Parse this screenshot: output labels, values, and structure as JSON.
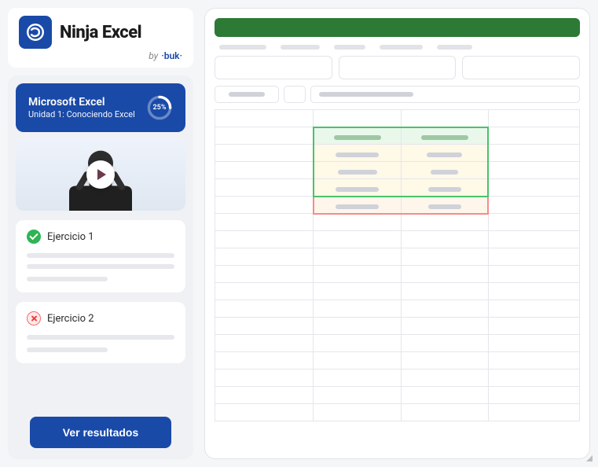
{
  "brand": {
    "name": "Ninja Excel",
    "by_prefix": "by",
    "by_brand": "·buk·"
  },
  "course": {
    "title": "Microsoft Excel",
    "subtitle": "Unidad 1: Conociendo Excel",
    "progress_pct": "25%",
    "progress_value": 25
  },
  "exercises": [
    {
      "label": "Ejercicio 1",
      "status": "ok"
    },
    {
      "label": "Ejercicio 2",
      "status": "bad"
    }
  ],
  "cta": {
    "label": "Ver resultados"
  }
}
